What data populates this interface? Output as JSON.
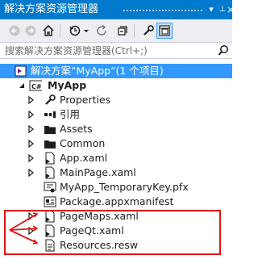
{
  "window": {
    "title": "解决方案资源管理器",
    "pin_glyph": "▾",
    "pin_glyph2": "⊥",
    "close_glyph": "×"
  },
  "search": {
    "placeholder": "搜索解决方案资源管理器(Ctrl+;)"
  },
  "tree": {
    "solution": "解决方案“MyApp”(1 个项目)",
    "project": "MyApp",
    "items": [
      {
        "label": "Properties",
        "icon": "wrench-icon"
      },
      {
        "label": "引用",
        "icon": "references-icon"
      },
      {
        "label": "Assets",
        "icon": "folder-icon"
      },
      {
        "label": "Common",
        "icon": "folder-icon"
      },
      {
        "label": "App.xaml",
        "icon": "xaml-file-icon"
      },
      {
        "label": "MainPage.xaml",
        "icon": "xaml-file-icon"
      },
      {
        "label": "MyApp_TemporaryKey.pfx",
        "icon": "certificate-icon"
      },
      {
        "label": "Package.appxmanifest",
        "icon": "manifest-icon"
      },
      {
        "label": "PageMaps.xaml",
        "icon": "xaml-file-icon"
      },
      {
        "label": "PageQt.xaml",
        "icon": "xaml-file-icon"
      },
      {
        "label": "Resources.resw",
        "icon": "resource-file-icon"
      }
    ]
  },
  "colors": {
    "accent": "#007acc",
    "selection": "#3399ff",
    "annotation": "#e01414"
  }
}
